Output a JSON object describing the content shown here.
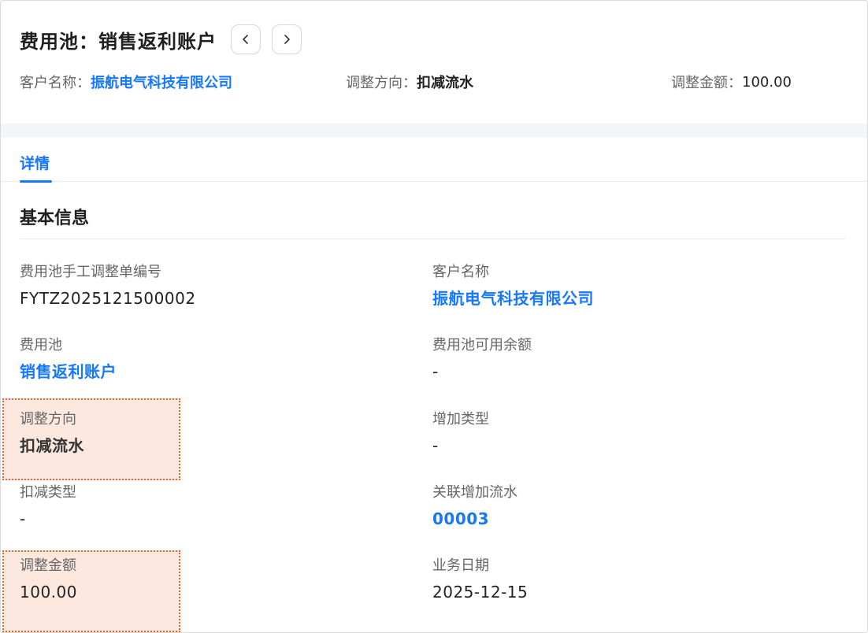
{
  "header": {
    "title": "费用池：销售返利账户",
    "prev_icon": "chevron-left-icon",
    "next_icon": "chevron-right-icon"
  },
  "summary": {
    "customer_label": "客户名称：",
    "customer_value": "振航电气科技有限公司",
    "direction_label": "调整方向：",
    "direction_value": "扣减流水",
    "amount_label": "调整金额：",
    "amount_value": "100.00"
  },
  "tabs": [
    {
      "label": "详情",
      "active": true
    }
  ],
  "section": {
    "title": "基本信息"
  },
  "fields": {
    "doc_no": {
      "label": "费用池手工调整单编号",
      "value": "FYTZ2025121500002"
    },
    "customer": {
      "label": "客户名称",
      "value": "振航电气科技有限公司"
    },
    "pool": {
      "label": "费用池",
      "value": "销售返利账户"
    },
    "balance": {
      "label": "费用池可用余额",
      "value": "-"
    },
    "direction": {
      "label": "调整方向",
      "value": "扣减流水"
    },
    "increase_type": {
      "label": "增加类型",
      "value": "-"
    },
    "deduct_type": {
      "label": "扣减类型",
      "value": "-"
    },
    "linked_flow": {
      "label": "关联增加流水",
      "value": "00003"
    },
    "amount": {
      "label": "调整金额",
      "value": "100.00"
    },
    "biz_date": {
      "label": "业务日期",
      "value": "2025-12-15"
    }
  },
  "colors": {
    "link": "#1677ff",
    "highlight_bg": "#fde8df",
    "highlight_border": "#e8642c"
  }
}
